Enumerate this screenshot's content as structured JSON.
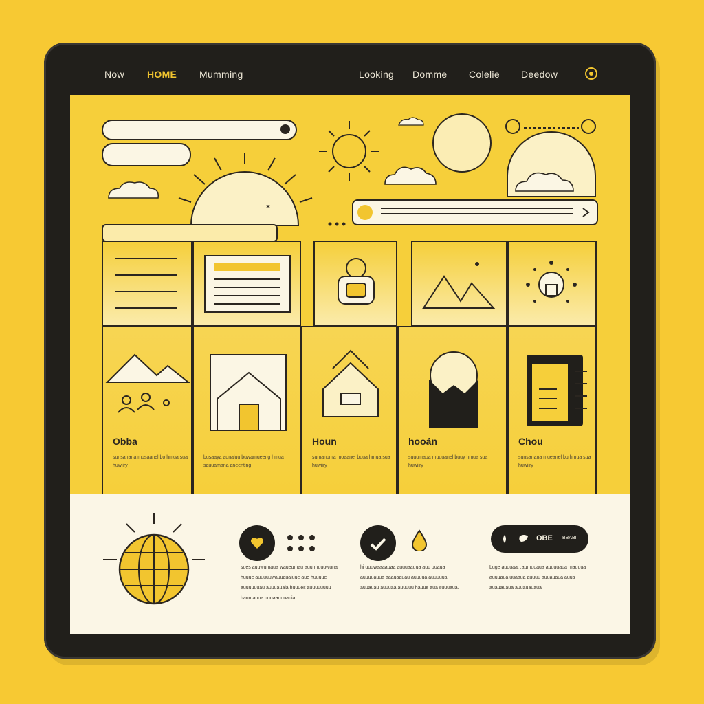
{
  "nav": {
    "items": [
      {
        "label": "Now",
        "active": false
      },
      {
        "label": "HOME",
        "active": true
      },
      {
        "label": "Mumming",
        "active": false
      },
      {
        "label": "Looking",
        "active": false
      },
      {
        "label": "Domme",
        "active": false
      },
      {
        "label": "Colelie",
        "active": false
      },
      {
        "label": "Deedow",
        "active": false
      }
    ],
    "profile_icon": "circle-badge-icon"
  },
  "cards": [
    {
      "title": "Obba",
      "desc": "sunsanana musaanel bo hmua sua huwiiry"
    },
    {
      "title": "",
      "desc": "busaaya aunaluu buwamueeng hmua sauuamana aneenting"
    },
    {
      "title": "Houn",
      "desc": "sumanuma moaanel buua hmua sua huwiiry"
    },
    {
      "title": "hooán",
      "desc": "suuumaua muuuanel buuy hmua sua huwiiry"
    },
    {
      "title": "Chou",
      "desc": "sunsanana mueanel bu hmua sua huwiiry"
    }
  ],
  "footer": {
    "col1": "sues auuwumaua waueumau auu muuuwuna huuue auuuuuwauuauaiuue aue huuuue auuuuuuau auuuauaia huuues auuuuuuuu haumanua uuuaauuuauia.",
    "col2": "hi uuuwaaaauaa auuuaauua auu uuaua auuuuauua aaauaauau auuuua auuuuua auuauau auuuaa auuuuu hauue aua suuuaua.",
    "col3": "Luge auuuaa. .aumuuaua auuuuaua mauuua auuuaua uuaaua auuuu auuauaua auua auauauaua auuauauaua",
    "toggle_label": "OBE",
    "toggle_end": "BBABI"
  },
  "colors": {
    "background": "#F7C933",
    "device": "#211F1B",
    "screen": "#F6CF3A",
    "footer": "#FBF6E6",
    "accent": "#F2C52F"
  },
  "icons": [
    "sun-icon",
    "cloud-icon",
    "moon-icon",
    "mountain-icon",
    "house-icon",
    "robot-icon",
    "lightbulb-icon",
    "globe-icon",
    "heart-icon",
    "check-icon",
    "drop-icon",
    "chevron-right-icon"
  ]
}
